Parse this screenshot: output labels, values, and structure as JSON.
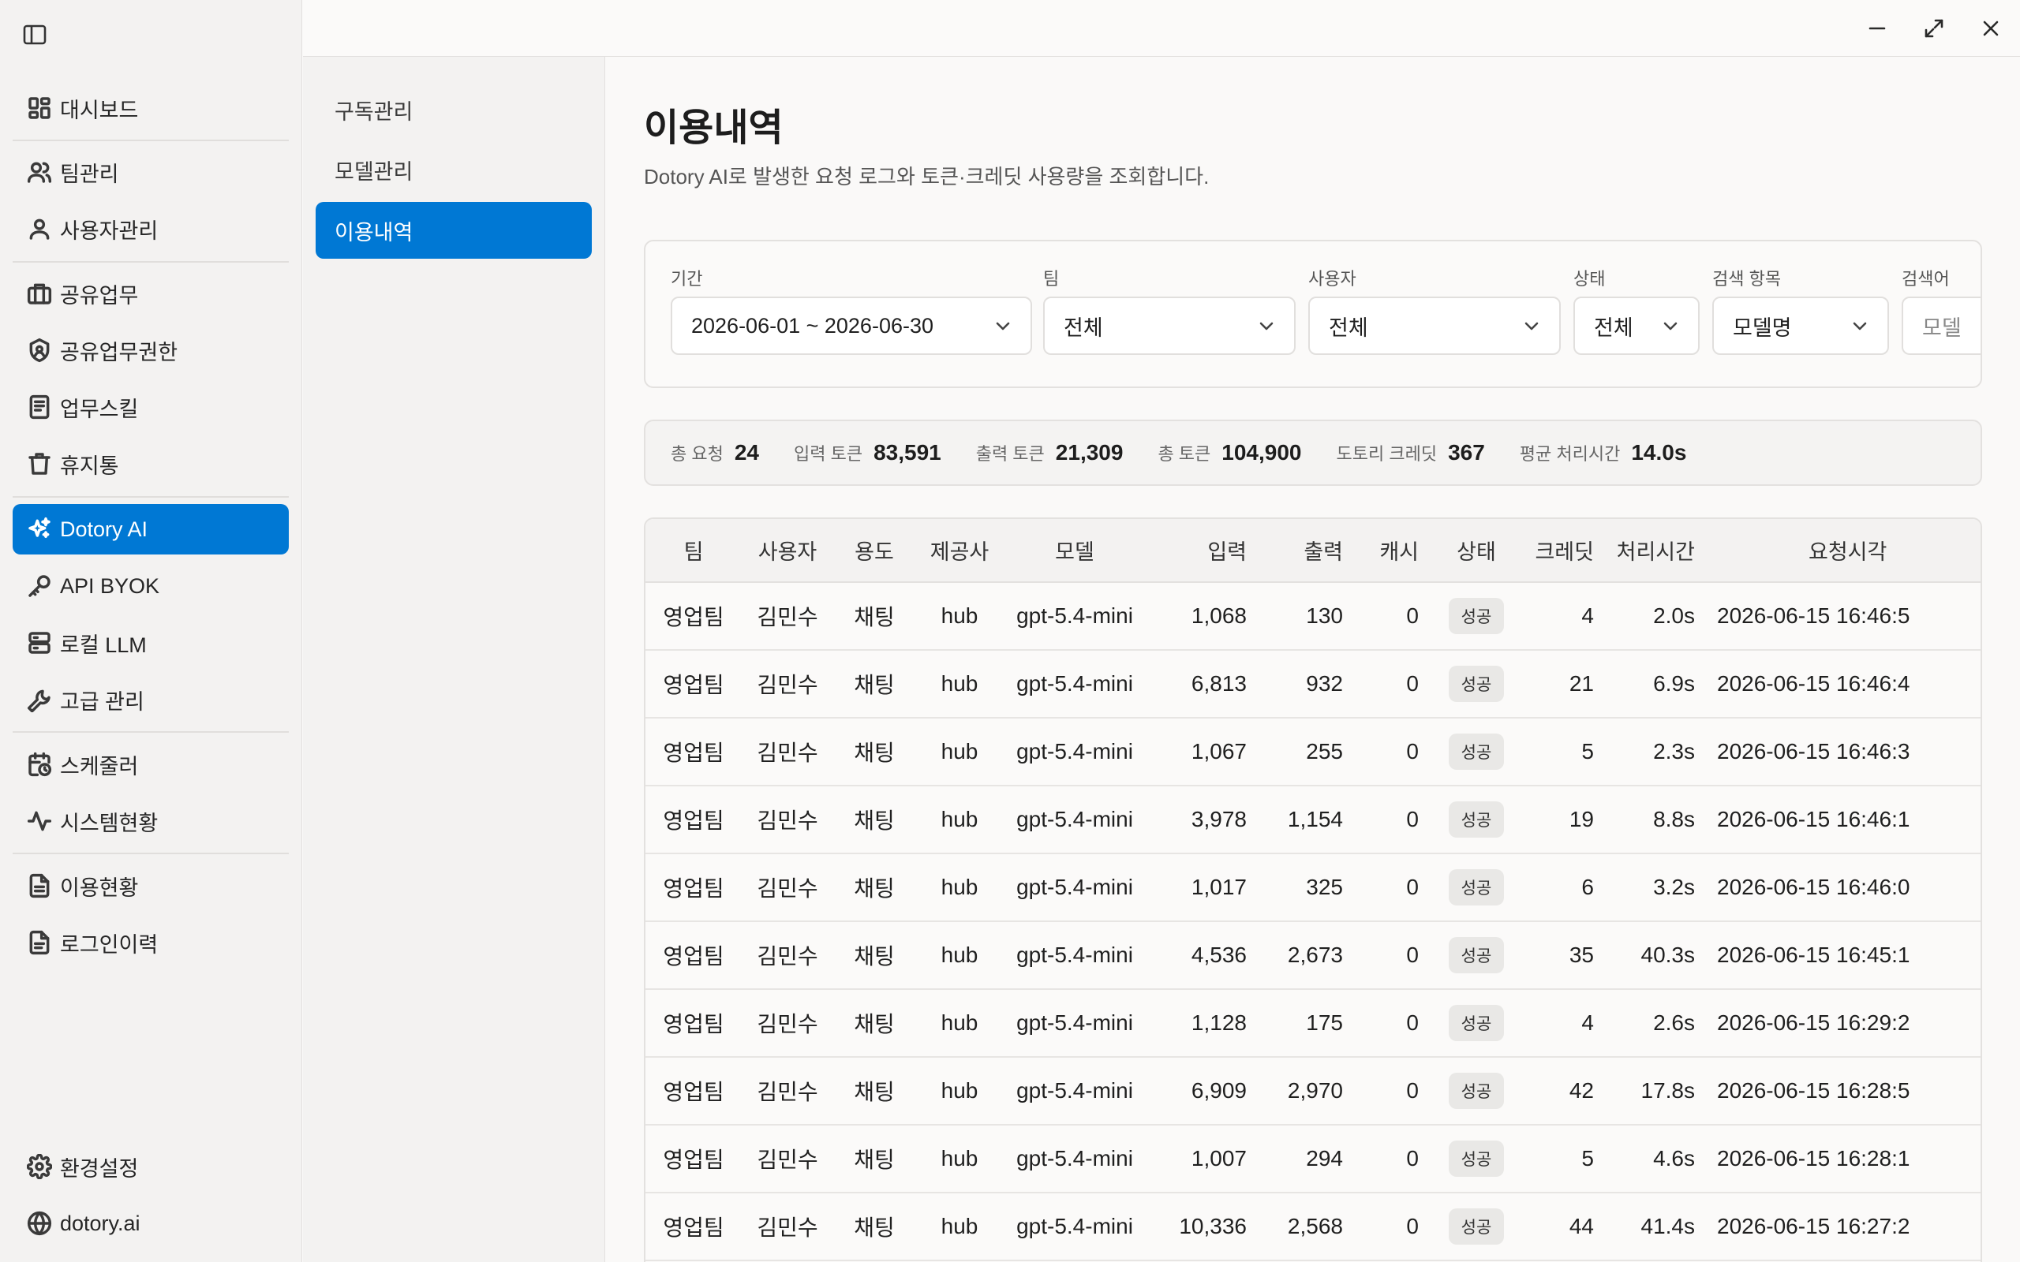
{
  "sidebar": {
    "items": [
      {
        "label": "대시보드",
        "icon": "dashboard-icon"
      },
      {
        "label": "팀관리",
        "icon": "users-icon"
      },
      {
        "label": "사용자관리",
        "icon": "user-icon"
      },
      {
        "label": "공유업무",
        "icon": "briefcase-icon"
      },
      {
        "label": "공유업무권한",
        "icon": "shield-icon"
      },
      {
        "label": "업무스킬",
        "icon": "document-icon"
      },
      {
        "label": "휴지통",
        "icon": "trash-icon"
      },
      {
        "label": "Dotory AI",
        "icon": "sparkle-icon",
        "active": true
      },
      {
        "label": "API BYOK",
        "icon": "key-icon"
      },
      {
        "label": "로컬 LLM",
        "icon": "server-icon"
      },
      {
        "label": "고급 관리",
        "icon": "wrench-icon"
      },
      {
        "label": "스케줄러",
        "icon": "calendar-clock-icon"
      },
      {
        "label": "시스템현황",
        "icon": "activity-icon"
      },
      {
        "label": "이용현황",
        "icon": "file-text-icon"
      },
      {
        "label": "로그인이력",
        "icon": "file-list-icon"
      }
    ],
    "bottom": [
      {
        "label": "환경설정",
        "icon": "gear-icon"
      },
      {
        "label": "dotory.ai",
        "icon": "globe-icon"
      }
    ]
  },
  "subnav": {
    "items": [
      {
        "label": "구독관리"
      },
      {
        "label": "모델관리"
      },
      {
        "label": "이용내역",
        "active": true
      }
    ]
  },
  "page": {
    "title": "이용내역",
    "description": "Dotory AI로 발생한 요청 로그와 토큰·크레딧 사용량을 조회합니다."
  },
  "filters": {
    "period": {
      "label": "기간",
      "value": "2026-06-01 ~ 2026-06-30"
    },
    "team": {
      "label": "팀",
      "value": "전체"
    },
    "user": {
      "label": "사용자",
      "value": "전체"
    },
    "status": {
      "label": "상태",
      "value": "전체"
    },
    "search_field": {
      "label": "검색 항목",
      "value": "모델명"
    },
    "search_term": {
      "label": "검색어",
      "placeholder": "모델"
    }
  },
  "summary": {
    "total_requests": {
      "label": "총 요청",
      "value": "24"
    },
    "input_tokens": {
      "label": "입력 토큰",
      "value": "83,591"
    },
    "output_tokens": {
      "label": "출력 토큰",
      "value": "21,309"
    },
    "total_tokens": {
      "label": "총 토큰",
      "value": "104,900"
    },
    "credits": {
      "label": "도토리 크레딧",
      "value": "367"
    },
    "avg_time": {
      "label": "평균 처리시간",
      "value": "14.0s"
    }
  },
  "table": {
    "columns": [
      "팀",
      "사용자",
      "용도",
      "제공사",
      "모델",
      "입력",
      "출력",
      "캐시",
      "상태",
      "크레딧",
      "처리시간",
      "요청시각"
    ],
    "rows": [
      [
        "영업팀",
        "김민수",
        "채팅",
        "hub",
        "gpt-5.4-mini",
        "1,068",
        "130",
        "0",
        "성공",
        "4",
        "2.0s",
        "2026-06-15 16:46:5"
      ],
      [
        "영업팀",
        "김민수",
        "채팅",
        "hub",
        "gpt-5.4-mini",
        "6,813",
        "932",
        "0",
        "성공",
        "21",
        "6.9s",
        "2026-06-15 16:46:4"
      ],
      [
        "영업팀",
        "김민수",
        "채팅",
        "hub",
        "gpt-5.4-mini",
        "1,067",
        "255",
        "0",
        "성공",
        "5",
        "2.3s",
        "2026-06-15 16:46:3"
      ],
      [
        "영업팀",
        "김민수",
        "채팅",
        "hub",
        "gpt-5.4-mini",
        "3,978",
        "1,154",
        "0",
        "성공",
        "19",
        "8.8s",
        "2026-06-15 16:46:1"
      ],
      [
        "영업팀",
        "김민수",
        "채팅",
        "hub",
        "gpt-5.4-mini",
        "1,017",
        "325",
        "0",
        "성공",
        "6",
        "3.2s",
        "2026-06-15 16:46:0"
      ],
      [
        "영업팀",
        "김민수",
        "채팅",
        "hub",
        "gpt-5.4-mini",
        "4,536",
        "2,673",
        "0",
        "성공",
        "35",
        "40.3s",
        "2026-06-15 16:45:1"
      ],
      [
        "영업팀",
        "김민수",
        "채팅",
        "hub",
        "gpt-5.4-mini",
        "1,128",
        "175",
        "0",
        "성공",
        "4",
        "2.6s",
        "2026-06-15 16:29:2"
      ],
      [
        "영업팀",
        "김민수",
        "채팅",
        "hub",
        "gpt-5.4-mini",
        "6,909",
        "2,970",
        "0",
        "성공",
        "42",
        "17.8s",
        "2026-06-15 16:28:5"
      ],
      [
        "영업팀",
        "김민수",
        "채팅",
        "hub",
        "gpt-5.4-mini",
        "1,007",
        "294",
        "0",
        "성공",
        "5",
        "4.6s",
        "2026-06-15 16:28:1"
      ],
      [
        "영업팀",
        "김민수",
        "채팅",
        "hub",
        "gpt-5.4-mini",
        "10,336",
        "2,568",
        "0",
        "성공",
        "44",
        "41.4s",
        "2026-06-15 16:27:2"
      ]
    ]
  },
  "colors": {
    "accent": "#0078d4",
    "sidebar_bg": "#f3f2f1",
    "page_bg": "#faf9f8"
  }
}
